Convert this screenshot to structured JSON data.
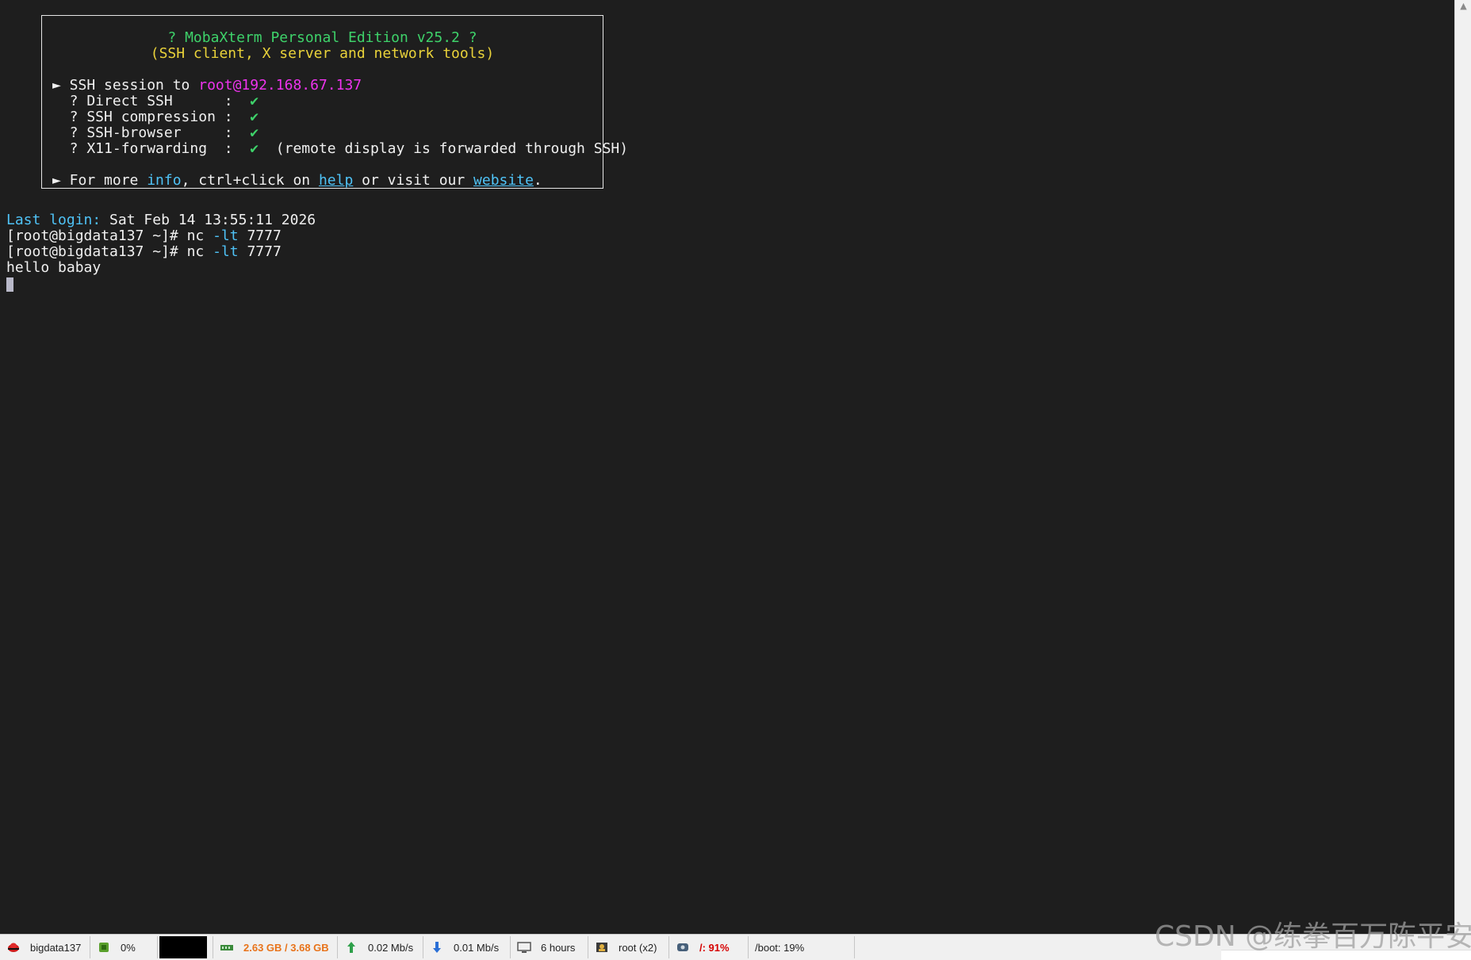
{
  "banner": {
    "title": "? MobaXterm Personal Edition v25.2 ?",
    "subtitle": "(SSH client, X server and network tools)",
    "session_prefix": "► SSH session to ",
    "session_target": "root@192.168.67.137",
    "features": [
      {
        "label": "  ? Direct SSH      :  ",
        "check": "✔",
        "note": ""
      },
      {
        "label": "  ? SSH compression :  ",
        "check": "✔",
        "note": ""
      },
      {
        "label": "  ? SSH-browser     :  ",
        "check": "✔",
        "note": ""
      },
      {
        "label": "  ? X11-forwarding  :  ",
        "check": "✔",
        "note": "  (remote display is forwarded through SSH)"
      }
    ],
    "more_prefix": "► For more ",
    "more_info": "info",
    "more_mid": ", ctrl+click on ",
    "more_help": "help",
    "more_mid2": " or visit our ",
    "more_website": "website",
    "more_end": "."
  },
  "terminal": {
    "last_login_label": "Last login:",
    "last_login_value": " Sat Feb 14 13:55:11 2026",
    "lines": [
      {
        "prompt": "[root@bigdata137 ~]# ",
        "cmd": "nc ",
        "flag": "-lt",
        "arg": " 7777"
      },
      {
        "prompt": "[root@bigdata137 ~]# ",
        "cmd": "nc ",
        "flag": "-lt",
        "arg": " 7777"
      }
    ],
    "output": "hello babay"
  },
  "statusbar": {
    "host": "bigdata137",
    "cpu": "0%",
    "memory": "2.63 GB / 3.68 GB",
    "upload": "0.02 Mb/s",
    "download": "0.01 Mb/s",
    "uptime": "6 hours",
    "users": "root (x2)",
    "disk_root": "/: 91%",
    "disk_boot": "/boot: 19%"
  },
  "watermark": "CSDN @练拳百万陈平安",
  "colors": {
    "background": "#1e1e1e",
    "green": "#3ed26a",
    "yellow": "#e9d23a",
    "magenta": "#ee33ee",
    "cyan": "#4fc3f7",
    "memory_orange": "#e8731a",
    "disk_red": "#d60000"
  }
}
